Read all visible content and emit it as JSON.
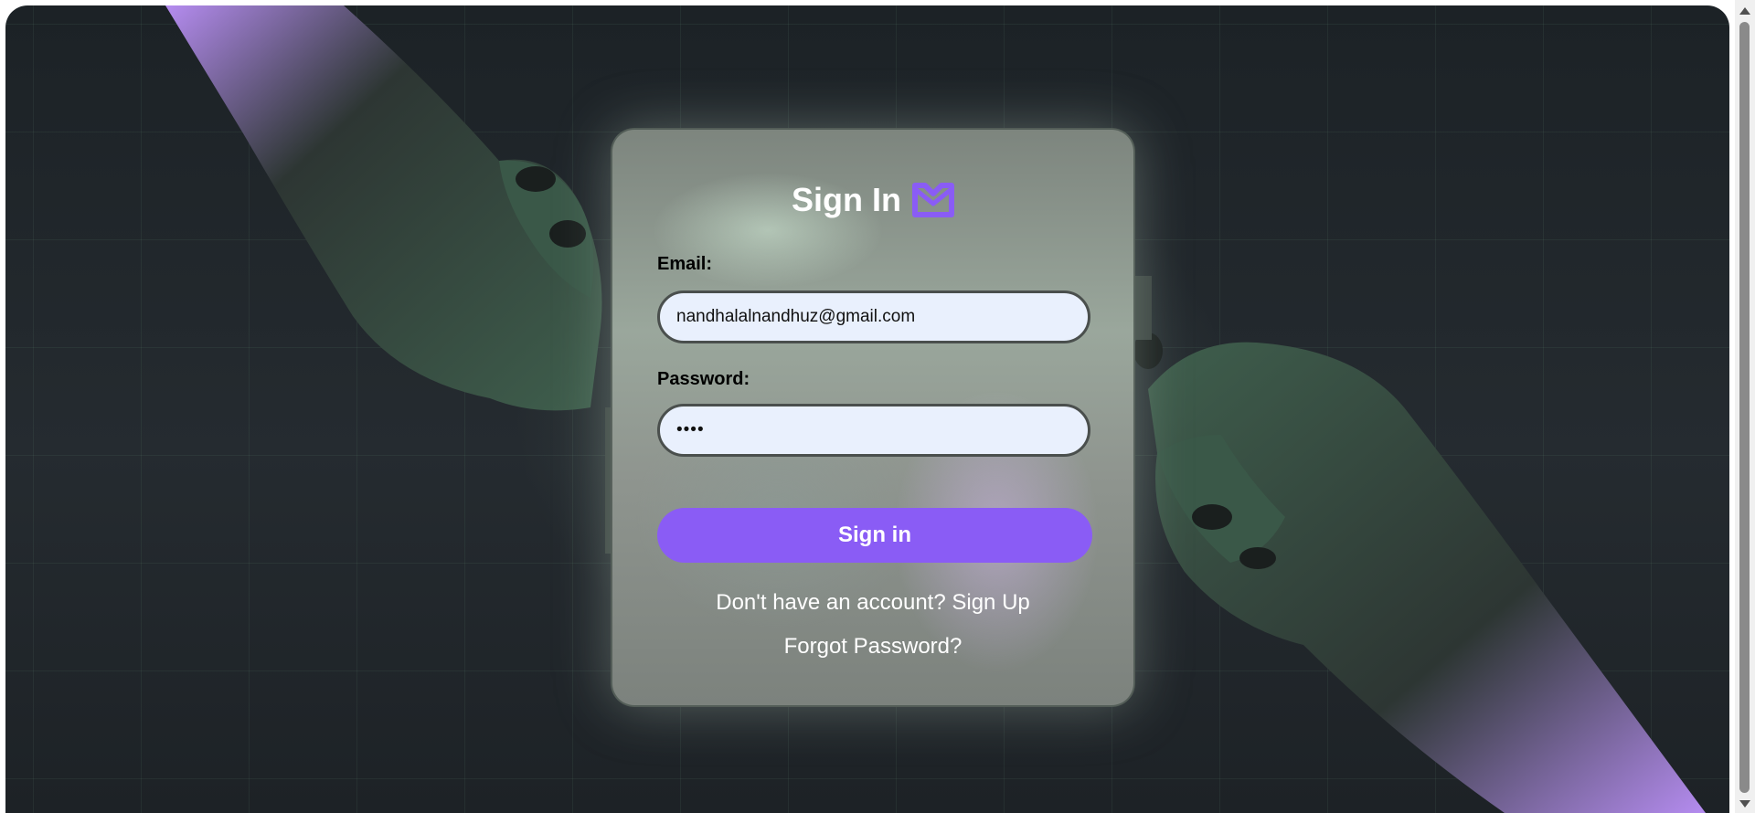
{
  "form": {
    "title": "Sign In",
    "logo_icon": "mail-envelope-icon",
    "email_label": "Email:",
    "email_value": "nandhalalnandhuz@gmail.com",
    "password_label": "Password:",
    "password_value": "••••",
    "submit_label": "Sign in",
    "signup_prefix": "Don't have an account?",
    "signup_link": "Sign Up",
    "forgot_link": "Forgot Password?"
  },
  "colors": {
    "accent": "#8a5cf5",
    "input_bg": "#e9f0fd",
    "background": "#1f2529",
    "hand_highlight": "#b18ae8",
    "hand_body": "#3c5a4a"
  }
}
